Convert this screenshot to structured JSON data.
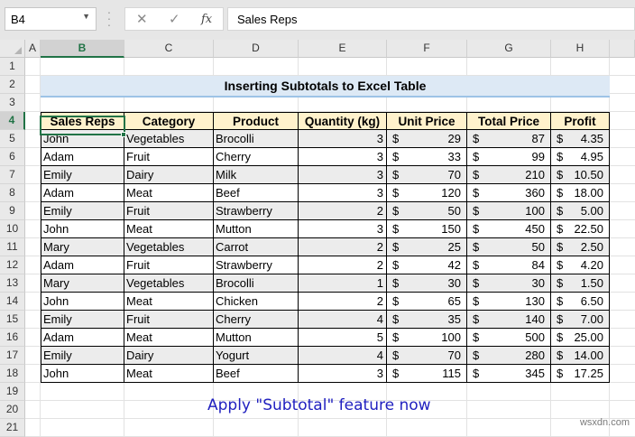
{
  "formula_bar": {
    "name_box": "B4",
    "cancel_symbol": "✕",
    "enter_symbol": "✓",
    "fx_symbol": "fx",
    "formula": "Sales Reps"
  },
  "columns": [
    "A",
    "B",
    "C",
    "D",
    "E",
    "F",
    "G",
    "H"
  ],
  "rows": [
    "1",
    "2",
    "3",
    "4",
    "5",
    "6",
    "7",
    "8",
    "9",
    "10",
    "11",
    "12",
    "13",
    "14",
    "15",
    "16",
    "17",
    "18",
    "19",
    "20",
    "21"
  ],
  "selected_cell": "B4",
  "title": "Inserting Subtotals to Excel Table",
  "table": {
    "headers": [
      "Sales Reps",
      "Category",
      "Product",
      "Quantity (kg)",
      "Unit Price",
      "Total Price",
      "Profit"
    ],
    "currency": "$",
    "rows": [
      [
        "John",
        "Vegetables",
        "Brocolli",
        "3",
        "29",
        "87",
        "4.35"
      ],
      [
        "Adam",
        "Fruit",
        "Cherry",
        "3",
        "33",
        "99",
        "4.95"
      ],
      [
        "Emily",
        "Dairy",
        "Milk",
        "3",
        "70",
        "210",
        "10.50"
      ],
      [
        "Adam",
        "Meat",
        "Beef",
        "3",
        "120",
        "360",
        "18.00"
      ],
      [
        "Emily",
        "Fruit",
        "Strawberry",
        "2",
        "50",
        "100",
        "5.00"
      ],
      [
        "John",
        "Meat",
        "Mutton",
        "3",
        "150",
        "450",
        "22.50"
      ],
      [
        "Mary",
        "Vegetables",
        "Carrot",
        "2",
        "25",
        "50",
        "2.50"
      ],
      [
        "Adam",
        "Fruit",
        "Strawberry",
        "2",
        "42",
        "84",
        "4.20"
      ],
      [
        "Mary",
        "Vegetables",
        "Brocolli",
        "1",
        "30",
        "30",
        "1.50"
      ],
      [
        "John",
        "Meat",
        "Chicken",
        "2",
        "65",
        "130",
        "6.50"
      ],
      [
        "Emily",
        "Fruit",
        "Cherry",
        "4",
        "35",
        "140",
        "7.00"
      ],
      [
        "Adam",
        "Meat",
        "Mutton",
        "5",
        "100",
        "500",
        "25.00"
      ],
      [
        "Emily",
        "Dairy",
        "Yogurt",
        "4",
        "70",
        "280",
        "14.00"
      ],
      [
        "John",
        "Meat",
        "Beef",
        "3",
        "115",
        "345",
        "17.25"
      ]
    ]
  },
  "note": "Apply \"Subtotal\" feature now",
  "watermark": "wsxdn.com",
  "colors": {
    "accent": "#217346",
    "header_fill": "#fff2cc",
    "title_fill": "#dde9f5",
    "note_text": "#1f1fbf"
  }
}
